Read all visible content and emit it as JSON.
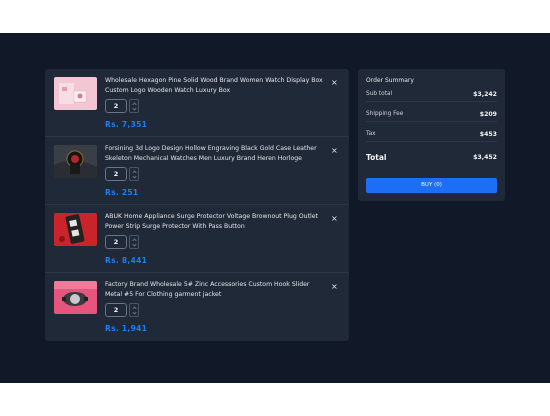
{
  "cart": {
    "items": [
      {
        "title": "Wholesale Hexagon Pine Solid Wood Brand Women Watch Display Box Custom Logo Wooden Watch Luxury Box",
        "qty": "2",
        "price": "Rs. 7,351",
        "thumb_icon": "watch-box-thumbnail"
      },
      {
        "title": "Forsining 3d Logo Design Hollow Engraving Black Gold Case Leather Skeleton Mechanical Watches Men Luxury Brand Heren Horloge",
        "qty": "2",
        "price": "Rs. 251",
        "thumb_icon": "watch-thumbnail"
      },
      {
        "title": "ABUK Home Appliance Surge Protector Voltage Brownout Plug Outlet Power Strip Surge Protector With Pass Button",
        "qty": "2",
        "price": "Rs. 8,441",
        "thumb_icon": "surge-protector-thumbnail"
      },
      {
        "title": "Factory Brand Wholesale 5# Zinc Accessories Custom Hook Slider Metal #5 For Clothing garment jacket",
        "qty": "2",
        "price": "Rs. 1,941",
        "thumb_icon": "zipper-slider-thumbnail"
      }
    ],
    "close_glyph": "×"
  },
  "summary": {
    "title": "Order Summary",
    "rows": [
      {
        "label": "Sub total",
        "value": "$3,242"
      },
      {
        "label": "Shipping Fee",
        "value": "$209"
      },
      {
        "label": "Tax",
        "value": "$453"
      },
      {
        "label": "Total",
        "value": "$3,452"
      }
    ],
    "buy_label": "BUY (0)"
  },
  "colors": {
    "page_bg": "#111827",
    "panel_bg": "#1f2937",
    "accent": "#1d7ef5",
    "button": "#1d6ef5"
  }
}
